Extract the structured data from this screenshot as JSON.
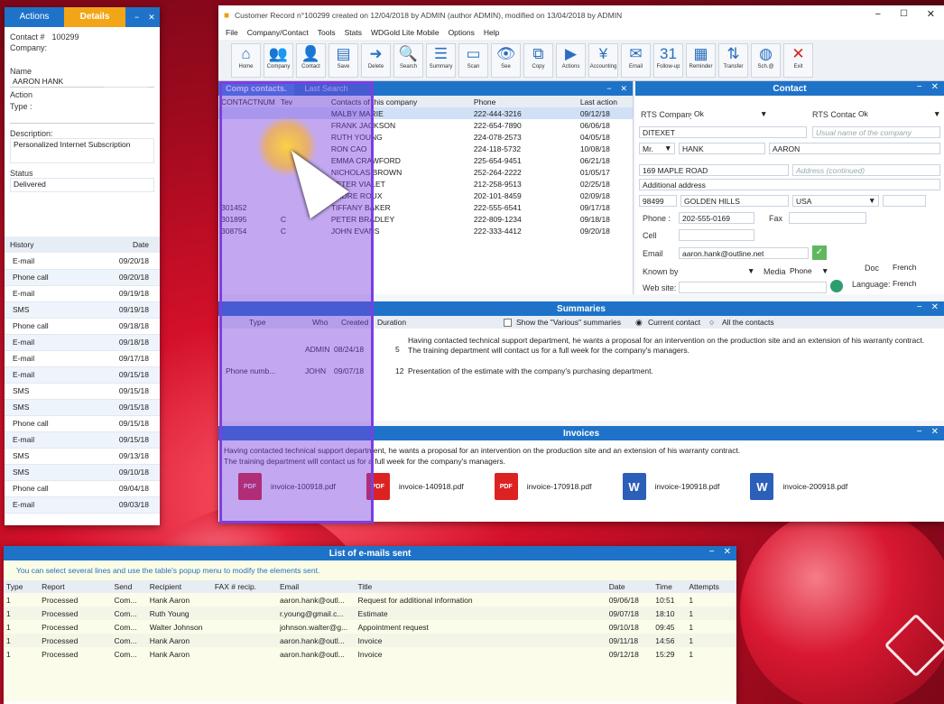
{
  "left_panel": {
    "tab_actions": "Actions",
    "tab_details": "Details",
    "contact_num_label": "Contact #",
    "contact_num": "100299",
    "company_label": "Company:",
    "name_label": "Name",
    "name_value": "AARON HANK",
    "action_label": "Action",
    "type_label": "Type :",
    "description_label": "Description:",
    "description_value": "Personalized Internet Subscription",
    "status_label": "Status",
    "status_value": "Delivered",
    "history_header": "History",
    "date_header": "Date",
    "history": [
      {
        "type": "E-mail",
        "date": "09/20/18"
      },
      {
        "type": "Phone call",
        "date": "09/20/18"
      },
      {
        "type": "E-mail",
        "date": "09/19/18"
      },
      {
        "type": "SMS",
        "date": "09/19/18"
      },
      {
        "type": "Phone call",
        "date": "09/18/18"
      },
      {
        "type": "E-mail",
        "date": "09/18/18"
      },
      {
        "type": "E-mail",
        "date": "09/17/18"
      },
      {
        "type": "E-mail",
        "date": "09/15/18"
      },
      {
        "type": "SMS",
        "date": "09/15/18"
      },
      {
        "type": "SMS",
        "date": "09/15/18"
      },
      {
        "type": "Phone call",
        "date": "09/15/18"
      },
      {
        "type": "E-mail",
        "date": "09/15/18"
      },
      {
        "type": "SMS",
        "date": "09/13/18"
      },
      {
        "type": "SMS",
        "date": "09/10/18"
      },
      {
        "type": "Phone call",
        "date": "09/04/18"
      },
      {
        "type": "E-mail",
        "date": "09/03/18"
      }
    ]
  },
  "main": {
    "title": "Customer Record n°100299 created on 12/04/2018 by ADMIN (author ADMIN), modified on 13/04/2018 by ADMIN",
    "menu": [
      "File",
      "Company/Contact",
      "Tools",
      "Stats",
      "WDGold Lite Mobile",
      "Options",
      "Help"
    ],
    "toolbar": [
      "Home",
      "Company",
      "Contact",
      "Save",
      "Delete",
      "Search",
      "Summary",
      "Scan",
      "See",
      "Copy",
      "Actions",
      "Accounting",
      "Email",
      "Follow-up",
      "Reminder",
      "Transfer",
      "Sch.@",
      "Exit"
    ],
    "toolbar_icons": [
      "home-icon",
      "company-icon",
      "add-contact-icon",
      "save-icon",
      "delete-icon",
      "search-icon",
      "summary-icon",
      "scan-icon",
      "see-icon",
      "copy-icon",
      "actions-icon",
      "accounting-icon",
      "email-icon",
      "follow-up-icon",
      "reminder-icon",
      "transfer-icon",
      "web-icon",
      "exit-icon"
    ],
    "toolbar_glyphs": [
      "⌂",
      "👥",
      "👤",
      "▤",
      "➜",
      "🔍",
      "☰",
      "▭",
      "👁",
      "⧉",
      "▶",
      "¥",
      "✉",
      "31",
      "▦",
      "⇅",
      "◍",
      "✕"
    ]
  },
  "contacts_panel": {
    "tab_comp": "Comp contacts.",
    "tab_last": "Last Search",
    "col_num": "CONTACTNUM",
    "col_tev": "Tev",
    "col_contact": "Contacts of this company",
    "col_phone": "Phone",
    "col_last": "Last action",
    "rows": [
      {
        "num": "",
        "tev": "",
        "name": "MALBY MARIE",
        "phone": "222-444-3216",
        "date": "09/12/18"
      },
      {
        "num": "",
        "tev": "",
        "name": "FRANK JACKSON",
        "phone": "222-654-7890",
        "date": "06/06/18"
      },
      {
        "num": "",
        "tev": "",
        "name": "RUTH YOUNG",
        "phone": "224-078-2573",
        "date": "04/05/18"
      },
      {
        "num": "",
        "tev": "",
        "name": "RON CAO",
        "phone": "224-118-5732",
        "date": "10/08/18"
      },
      {
        "num": "",
        "tev": "",
        "name": "EMMA CRAWFORD",
        "phone": "225-654-9451",
        "date": "06/21/18"
      },
      {
        "num": "",
        "tev": "",
        "name": "NICHOLAS BROWN",
        "phone": "252-264-2222",
        "date": "01/05/17"
      },
      {
        "num": "",
        "tev": "",
        "name": "PETER VIALET",
        "phone": "212-258-9513",
        "date": "02/25/18"
      },
      {
        "num": "",
        "tev": "",
        "name": "ANDRE ROUX",
        "phone": "202-101-8459",
        "date": "02/09/18"
      },
      {
        "num": "301452",
        "tev": "",
        "name": "TIFFANY BAKER",
        "phone": "222-555-6541",
        "date": "09/17/18"
      },
      {
        "num": "301895",
        "tev": "C",
        "name": "PETER BRADLEY",
        "phone": "222-809-1234",
        "date": "09/18/18"
      },
      {
        "num": "308754",
        "tev": "C",
        "name": "JOHN EVANS",
        "phone": "222-333-4412",
        "date": "09/20/18"
      }
    ]
  },
  "contact_panel": {
    "title": "Contact",
    "rts_company_label": "RTS Company:",
    "rts_company": "Ok",
    "rts_contact_label": "RTS Contact:",
    "rts_contact": "Ok",
    "company_name": "DITEXET",
    "company_placeholder": "Usual name of the company",
    "title_value": "Mr.",
    "last_name": "HANK",
    "first_name": "AARON",
    "address": "169 MAPLE ROAD",
    "address_placeholder": "Address (continued)",
    "additional_address": "Additional address",
    "zip": "98499",
    "city": "GOLDEN HILLS",
    "country": "USA",
    "phone_label": "Phone :",
    "phone": "202-555-0169",
    "fax_label": "Fax",
    "cell_label": "Cell",
    "email_label": "Email",
    "email": "aaron.hank@outline.net",
    "known_by_label": "Known by:",
    "media_label": "Media",
    "media": "Phone",
    "doc_label": "Doc",
    "doc": "French",
    "website_label": "Web site:",
    "language_label": "Language:",
    "language": "French"
  },
  "summaries": {
    "title": "Summaries",
    "col_type": "Type",
    "col_who": "Who",
    "col_created": "Created",
    "col_duration": "Duration",
    "opt_various": "Show the \"Various\" summaries",
    "opt_current": "Current contact",
    "opt_all": "All the contacts",
    "rows": [
      {
        "type": "",
        "who": "ADMIN",
        "created": "08/24/18",
        "duration": "5",
        "text": "Having contacted technical support department, he wants a proposal for an intervention on the production site and an extension of his warranty contract.\nThe training department will contact us for a full week for the company's managers."
      },
      {
        "type": "Phone numb...",
        "who": "JOHN",
        "created": "09/07/18",
        "duration": "12",
        "text": "Presentation of the estimate with the company's purchasing department."
      }
    ]
  },
  "invoices": {
    "title": "Invoices",
    "text1": "Having contacted technical support department, he wants a proposal for an intervention on the production site and an extension of his warranty contract.",
    "text2": "The training department will contact us for a full week for the company's managers.",
    "files": [
      {
        "name": "invoice-100918.pdf",
        "kind": "PDF"
      },
      {
        "name": "invoice-140918.pdf",
        "kind": "PDF"
      },
      {
        "name": "invoice-170918.pdf",
        "kind": "PDF"
      },
      {
        "name": "invoice-190918.pdf",
        "kind": "W"
      },
      {
        "name": "invoice-200918.pdf",
        "kind": "W"
      }
    ]
  },
  "emails": {
    "title": "List of e-mails sent",
    "hint": "You can select several lines and use the table's popup menu to modify the elements sent.",
    "cols": [
      "Type",
      "Report",
      "Send",
      "Recipient",
      "FAX # recip.",
      "Email",
      "Title",
      "Date",
      "Time",
      "Attempts"
    ],
    "rows": [
      [
        "1",
        "Processed",
        "Com...",
        "Hank Aaron",
        "",
        "aaron.hank@outl...",
        "Request for additional information",
        "09/06/18",
        "10:51",
        "1"
      ],
      [
        "1",
        "Processed",
        "Com...",
        "Ruth Young",
        "",
        "r.young@gmail.c...",
        "Estimate",
        "09/07/18",
        "18:10",
        "1"
      ],
      [
        "1",
        "Processed",
        "Com...",
        "Walter Johnson",
        "",
        "johnson.walter@g...",
        "Appointment request",
        "09/10/18",
        "09:45",
        "1"
      ],
      [
        "1",
        "Processed",
        "Com...",
        "Hank Aaron",
        "",
        "aaron.hank@outl...",
        "Invoice",
        "09/11/18",
        "14:56",
        "1"
      ],
      [
        "1",
        "Processed",
        "Com...",
        "Hank Aaron",
        "",
        "aaron.hank@outl...",
        "Invoice",
        "09/12/18",
        "15:29",
        "1"
      ]
    ]
  },
  "colors": {
    "accent": "#1e73c8",
    "highlight": "#7a3fe0",
    "tab_active": "#f2a516"
  }
}
